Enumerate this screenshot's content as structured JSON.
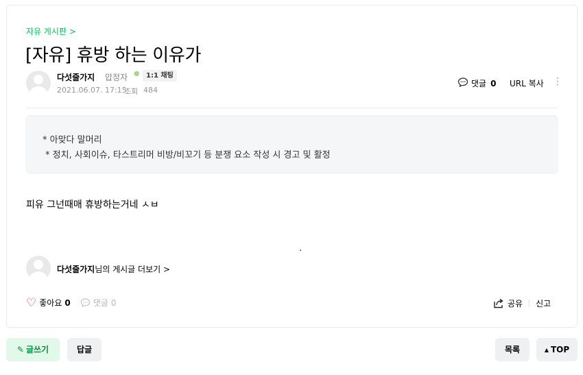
{
  "board": {
    "name_link": "자유 게시판 >"
  },
  "post": {
    "title": "[자유] 휴방 하는 이유가",
    "author": {
      "name": "다섯줄가지",
      "level": "압정자",
      "level_icon": "sprout-icon",
      "chat_label": "1:1 채팅"
    },
    "date": "2021.06.07. 17:15",
    "views_label": "조회",
    "views": "484",
    "notice": {
      "line1": "* 아맞다 말머리",
      "line2": "* 정치, 사회이슈, 타스트리머 비방/비꼬기 등 분쟁 요소 작성 시 경고 및 활정"
    },
    "body": "피유 그넌때매 휴방하는거네 ㅅㅂ"
  },
  "tools": {
    "comment_label": "댓글",
    "comment_count": "0",
    "url_copy": "URL 복사"
  },
  "more_posts": {
    "author": "다섯줄가지",
    "suffix": "님의 게시글 더보기 >"
  },
  "reactions": {
    "like_label": "좋아요",
    "like_count": "0",
    "comment_label": "댓글",
    "comment_count": "0",
    "share_label": "공유",
    "report_label": "신고"
  },
  "buttons": {
    "write": "글쓰기",
    "reply": "답글",
    "list": "목록",
    "top": "TOP"
  },
  "colors": {
    "accent": "#03c75a",
    "like_heart": "#e03c3c",
    "write_button_bg": "#e2f8e9"
  }
}
